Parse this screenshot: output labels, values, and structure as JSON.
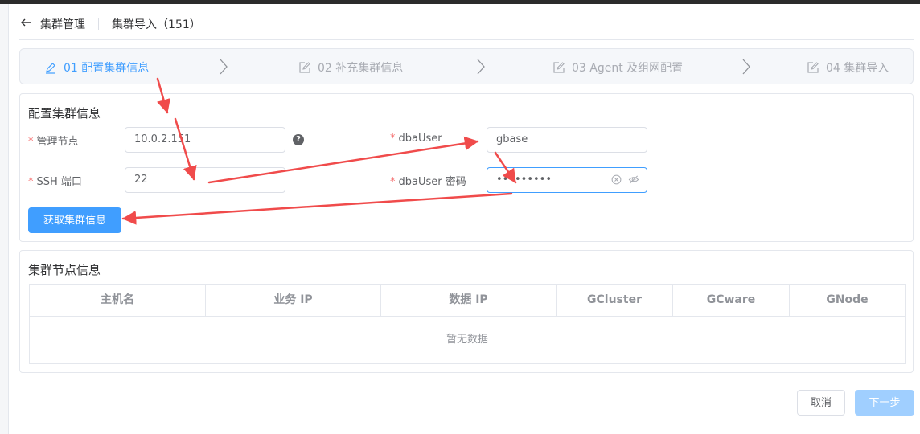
{
  "header": {
    "back_label": "",
    "crumb": "集群管理",
    "title": "集群导入（151）"
  },
  "steps": [
    {
      "label": "01 配置集群信息",
      "icon": "edit-pencil-icon",
      "active": true
    },
    {
      "label": "02 补充集群信息",
      "icon": "edit-square-icon",
      "active": false
    },
    {
      "label": "03 Agent 及组网配置",
      "icon": "edit-square-icon",
      "active": false
    },
    {
      "label": "04 集群导入",
      "icon": "edit-square-icon",
      "active": false
    }
  ],
  "config": {
    "title": "配置集群信息",
    "required_mark": "*",
    "mgmt_node_label": "管理节点",
    "mgmt_node_value": "10.0.2.151",
    "ssh_port_label": "SSH 端口",
    "ssh_port_value": "22",
    "dba_user_label": "dbaUser",
    "dba_user_value": "gbase",
    "dba_pwd_label": "dbaUser 密码",
    "dba_pwd_value": "•••••••••",
    "fetch_button": "获取集群信息"
  },
  "nodes": {
    "title": "集群节点信息",
    "columns": [
      "主机名",
      "业务 IP",
      "数据 IP",
      "GCluster",
      "GCware",
      "GNode"
    ],
    "empty_text": "暂无数据"
  },
  "footer": {
    "cancel": "取消",
    "next": "下一步"
  },
  "colors": {
    "primary": "#409eff",
    "annotation_arrow": "#f04b4b",
    "required": "#f56c6c"
  }
}
